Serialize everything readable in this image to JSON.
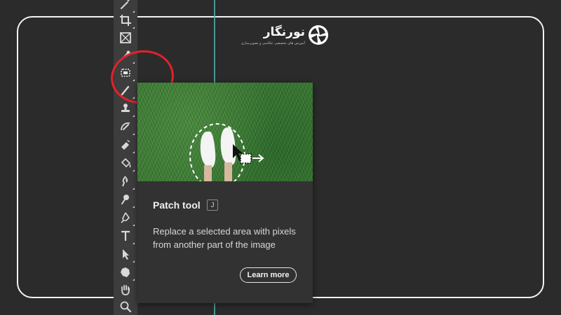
{
  "logo": {
    "name": "نورنگار",
    "tagline": "آموزش های تخصصی عکاسی و تصویرسازی",
    "icon": "aperture-icon"
  },
  "toolbar": {
    "tools": [
      {
        "name": "magic-wand-tool",
        "icon": "magic-wand-icon"
      },
      {
        "name": "crop-tool",
        "icon": "crop-icon"
      },
      {
        "name": "frame-tool",
        "icon": "frame-icon"
      },
      {
        "name": "eyedropper-tool",
        "icon": "eyedropper-icon"
      },
      {
        "name": "patch-tool",
        "icon": "patch-icon",
        "selected": true
      },
      {
        "name": "brush-tool",
        "icon": "brush-icon"
      },
      {
        "name": "clone-stamp-tool",
        "icon": "stamp-icon"
      },
      {
        "name": "history-brush-tool",
        "icon": "history-brush-icon"
      },
      {
        "name": "eraser-tool",
        "icon": "eraser-icon"
      },
      {
        "name": "paint-bucket-tool",
        "icon": "paint-bucket-icon"
      },
      {
        "name": "blur-tool",
        "icon": "blur-icon"
      },
      {
        "name": "dodge-tool",
        "icon": "dodge-icon"
      },
      {
        "name": "pen-tool",
        "icon": "pen-icon"
      },
      {
        "name": "type-tool",
        "icon": "type-icon"
      },
      {
        "name": "path-selection-tool",
        "icon": "arrow-icon"
      },
      {
        "name": "shape-tool",
        "icon": "shape-icon"
      },
      {
        "name": "hand-tool",
        "icon": "hand-icon"
      },
      {
        "name": "zoom-tool",
        "icon": "zoom-icon"
      }
    ]
  },
  "tooltip": {
    "title": "Patch tool",
    "shortcut": "J",
    "description": "Replace a selected area with pixels from another part of the image",
    "learn_more_label": "Learn more"
  },
  "colors": {
    "background": "#2b2b2b",
    "toolbar": "#3d3d3d",
    "tooltip": "#323232",
    "highlight": "#e5212b",
    "guide": "#4fb3b0"
  }
}
